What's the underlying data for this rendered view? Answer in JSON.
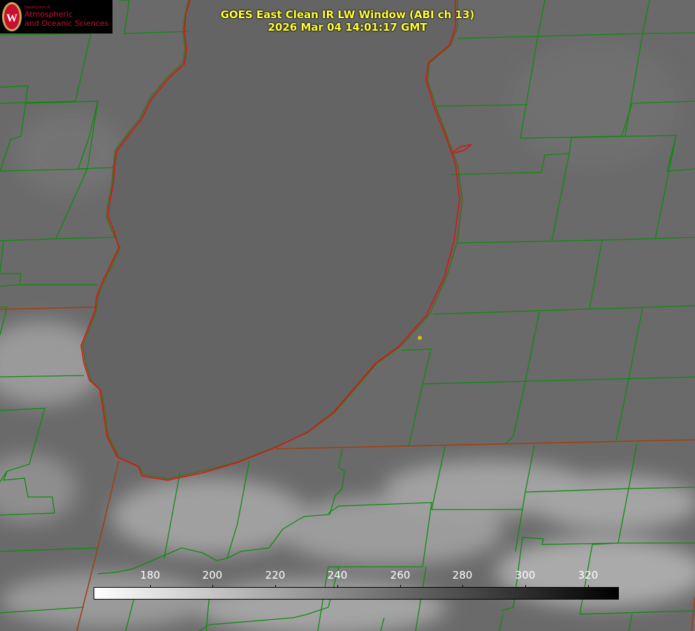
{
  "title": {
    "line1": "GOES East Clean IR LW Window (ABI ch 13)",
    "line2": "2026 Mar 04 14:01:17 GMT"
  },
  "logo": {
    "department": "Department of",
    "line1": "Atmospheric",
    "line2": "and Oceanic Sciences",
    "color": "#c8102e"
  },
  "colorbar": {
    "tick_labels": [
      "180",
      "200",
      "220",
      "240",
      "260",
      "280",
      "300",
      "320"
    ],
    "gradient_start": "#ffffff",
    "gradient_end": "#000000"
  },
  "colors": {
    "county_lines": "#0d8a0d",
    "coastline": "#e01010",
    "state_lines": "#a04010",
    "marker": "#d4c000",
    "title": "#ffff32"
  }
}
